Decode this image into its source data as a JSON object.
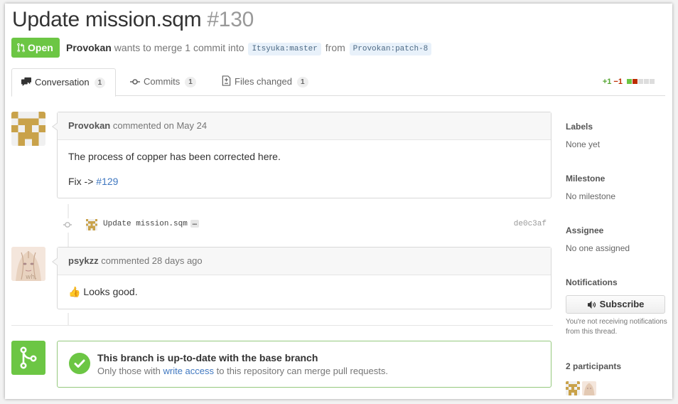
{
  "pr": {
    "title": "Update mission.sqm",
    "number": "#130",
    "state_label": "Open",
    "author": "Provokan",
    "merge_text_1": "wants to merge 1 commit into",
    "base_ref": "Itsyuka:master",
    "from_word": "from",
    "head_ref": "Provokan:patch-8"
  },
  "tabs": [
    {
      "label": "Conversation",
      "count": "1",
      "icon": "comment-discussion-icon"
    },
    {
      "label": "Commits",
      "count": "1",
      "icon": "git-commit-icon"
    },
    {
      "label": "Files changed",
      "count": "1",
      "icon": "diff-icon"
    }
  ],
  "diffstat": {
    "additions": "+1",
    "deletions": "−1"
  },
  "comments": [
    {
      "author": "Provokan",
      "time": "commented on May 24",
      "body_1": "The process of copper has been corrected here.",
      "fix_prefix": "Fix ->",
      "fix_link": "#129"
    },
    {
      "author": "psykzz",
      "time": "commented 28 days ago",
      "emoji": "👍",
      "body": "Looks good."
    }
  ],
  "commit": {
    "message": "Update mission.sqm",
    "ellipsis": "…",
    "sha": "de0c3af"
  },
  "merge": {
    "heading": "This branch is up-to-date with the base branch",
    "sub_1": "Only those with",
    "sub_link": "write access",
    "sub_2": "to this repository can merge pull requests."
  },
  "sidebar": {
    "labels_title": "Labels",
    "labels_value": "None yet",
    "milestone_title": "Milestone",
    "milestone_value": "No milestone",
    "assignee_title": "Assignee",
    "assignee_value": "No one assigned",
    "notifications_title": "Notifications",
    "subscribe_label": "Subscribe",
    "notifications_note": "You're not receiving notifications from this thread.",
    "participants_title": "2 participants"
  },
  "colors": {
    "open_green": "#6cc644",
    "link_blue": "#4078c0",
    "deletion_red": "#bd2c00"
  }
}
